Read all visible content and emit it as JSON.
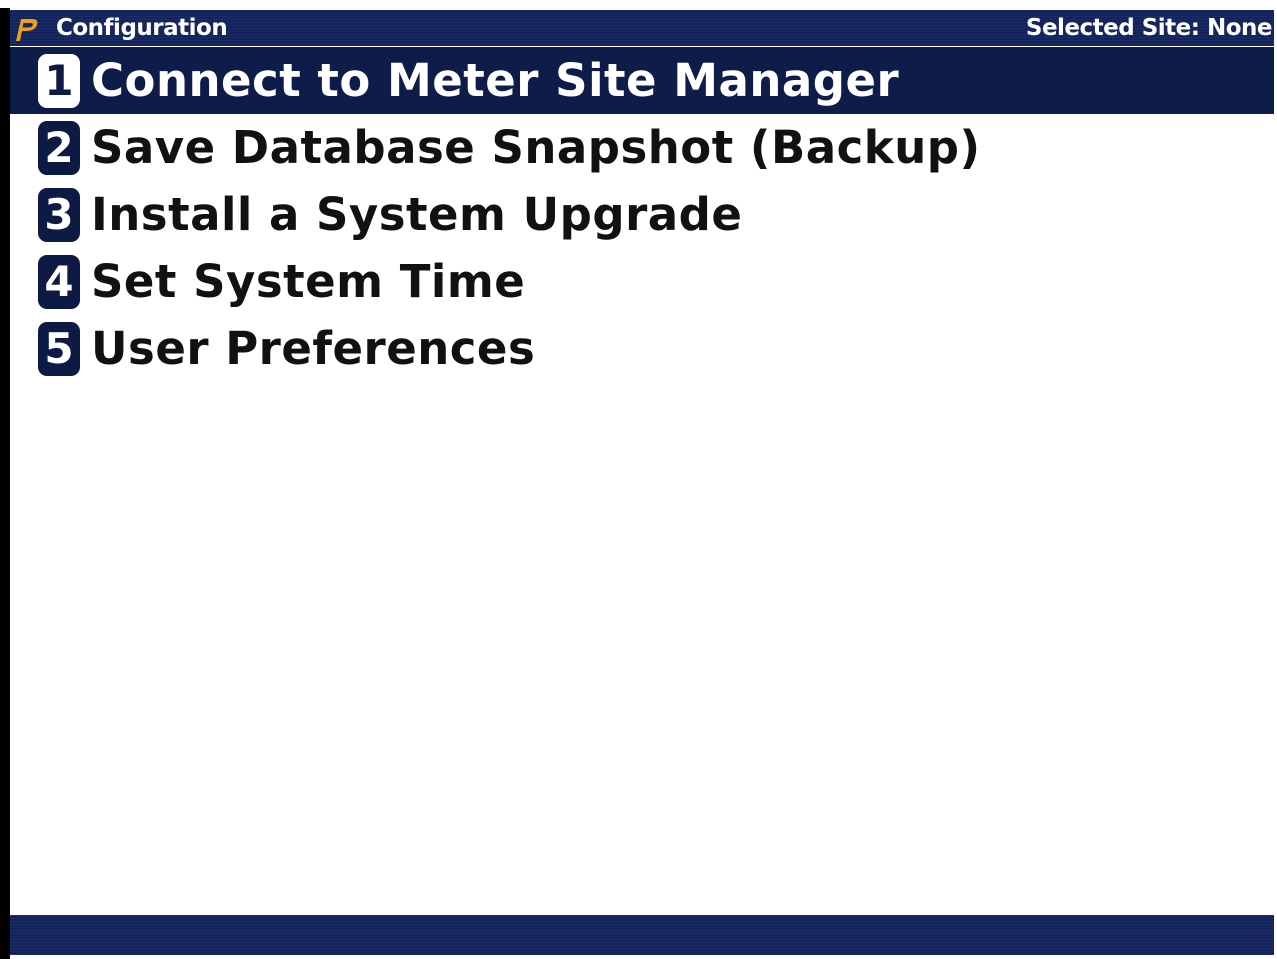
{
  "window": {
    "title": "Configuration",
    "selected_site": "Selected Site: None",
    "logo_icon": "p-logo-icon"
  },
  "menu": {
    "items": [
      {
        "number": "1",
        "label": "Connect to Meter Site Manager",
        "selected": true
      },
      {
        "number": "2",
        "label": "Save Database Snapshot (Backup)",
        "selected": false
      },
      {
        "number": "3",
        "label": "Install a System Upgrade",
        "selected": false
      },
      {
        "number": "4",
        "label": "Set System Time",
        "selected": false
      },
      {
        "number": "5",
        "label": "User Preferences",
        "selected": false
      }
    ]
  },
  "colors": {
    "titlebar": "#16265c",
    "selection": "#0d1c49",
    "badge": "#0d1a44",
    "logo": "#e8a020"
  }
}
